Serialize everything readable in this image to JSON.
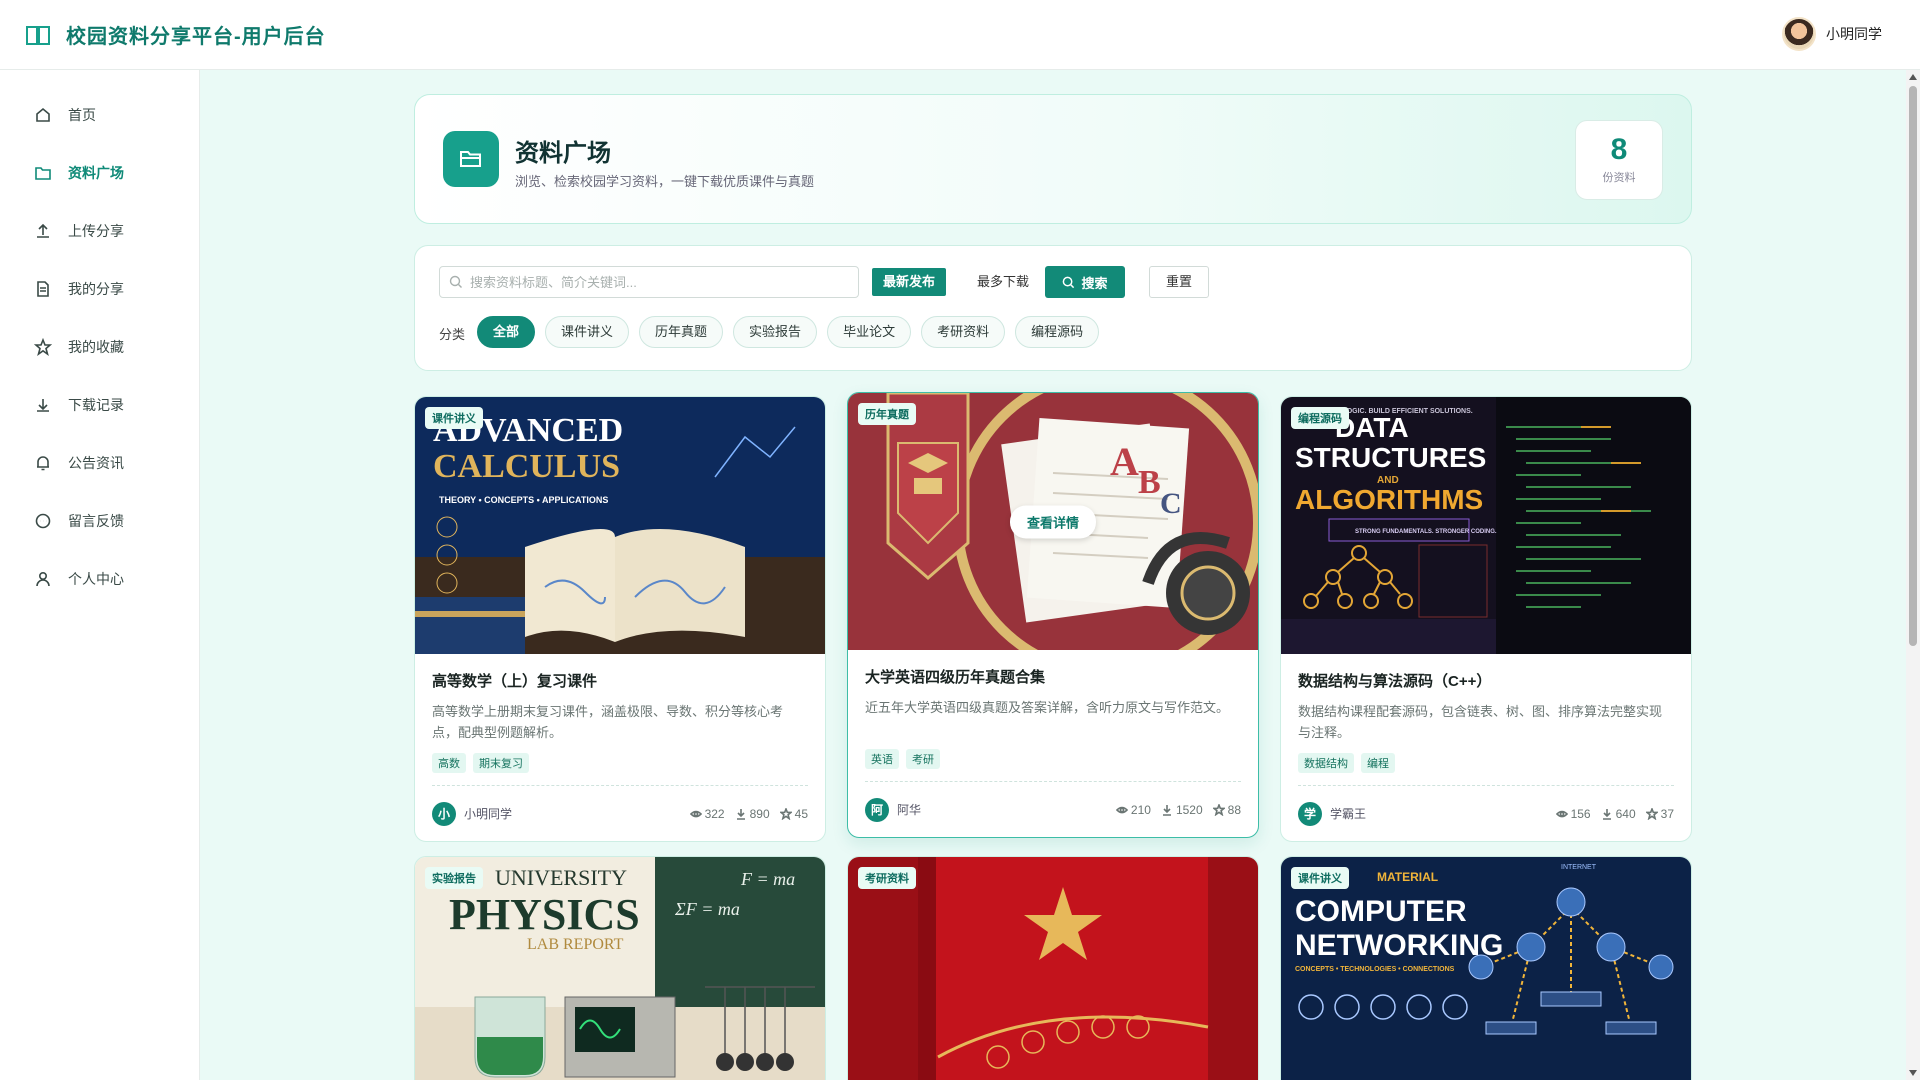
{
  "header": {
    "title": "校园资料分享平台-用户后台",
    "user_name": "小明同学"
  },
  "sidebar": {
    "items": [
      {
        "label": "首页",
        "icon": "home-icon"
      },
      {
        "label": "资料广场",
        "icon": "folder-icon",
        "active": true
      },
      {
        "label": "上传分享",
        "icon": "upload-icon"
      },
      {
        "label": "我的分享",
        "icon": "document-icon"
      },
      {
        "label": "我的收藏",
        "icon": "star-icon"
      },
      {
        "label": "下载记录",
        "icon": "download-icon"
      },
      {
        "label": "公告资讯",
        "icon": "bell-icon"
      },
      {
        "label": "留言反馈",
        "icon": "message-icon"
      },
      {
        "label": "个人中心",
        "icon": "user-icon"
      }
    ]
  },
  "hero": {
    "title": "资料广场",
    "subtitle": "浏览、检索校园学习资料，一键下载优质课件与真题",
    "count": "8",
    "count_label": "份资料"
  },
  "filter": {
    "search_placeholder": "搜索资料标题、简介关键词...",
    "sort_latest": "最新发布",
    "sort_downloads": "最多下载",
    "search_button": "搜索",
    "reset_button": "重置",
    "category_label": "分类",
    "categories": [
      "全部",
      "课件讲义",
      "历年真题",
      "实验报告",
      "毕业论文",
      "考研资料",
      "编程源码"
    ]
  },
  "cards": [
    {
      "badge": "课件讲义",
      "title": "高等数学（上）复习课件",
      "desc": "高等数学上册期末复习课件，涵盖极限、导数、积分等核心考点，配典型例题解析。",
      "tags": [
        "高数",
        "期末复习"
      ],
      "author_initial": "小",
      "author": "小明同学",
      "views": "322",
      "downloads": "890",
      "stars": "45",
      "cover_text": [
        "ADVANCED",
        "CALCULUS",
        "THEORY • CONCEPTS • APPLICATIONS"
      ]
    },
    {
      "badge": "历年真题",
      "title": "大学英语四级历年真题合集",
      "desc": "近五年大学英语四级真题及答案详解，含听力原文与写作范文。",
      "tags": [
        "英语",
        "考研"
      ],
      "author_initial": "阿",
      "author": "阿华",
      "views": "210",
      "downloads": "1520",
      "stars": "88",
      "view_detail": "查看详情",
      "cover_text": [
        "A",
        "B",
        "C"
      ]
    },
    {
      "badge": "编程源码",
      "title": "数据结构与算法源码（C++）",
      "desc": "数据结构课程配套源码，包含链表、树、图、排序算法完整实现与注释。",
      "tags": [
        "数据结构",
        "编程"
      ],
      "author_initial": "学",
      "author": "学霸王",
      "views": "156",
      "downloads": "640",
      "stars": "37",
      "cover_text": [
        "DATA",
        "STRUCTURES",
        "AND",
        "ALGORITHMS",
        "STRONG FUNDAMENTALS. STRONGER CODING.",
        "MASTER THE LOGIC. BUILD EFFICIENT SOLUTIONS."
      ]
    },
    {
      "badge": "实验报告",
      "cover_text": [
        "UNIVERSITY",
        "PHYSICS",
        "LAB REPORT",
        "F = ma",
        "ΣF = ma"
      ]
    },
    {
      "badge": "考研资料",
      "cover_text": []
    },
    {
      "badge": "课件讲义",
      "cover_text": [
        "MATERIAL",
        "COMPUTER",
        "NETWORKING",
        "CONCEPTS • TECHNOLOGIES • CONNECTIONS",
        "INTERNET"
      ]
    }
  ],
  "colors": {
    "primary": "#128a78",
    "bg": "#eafaf6"
  }
}
